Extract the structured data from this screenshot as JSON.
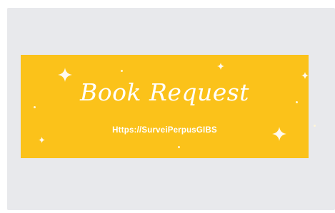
{
  "banner": {
    "title": "Book Request",
    "url": "Https://SurveiPerpusGIBS"
  },
  "colors": {
    "banner_bg": "#fbc21a",
    "text": "#ffffff",
    "backdrop": "#e8e9ec"
  },
  "decorations": {
    "sparkle_icon": "sparkle-star-icon"
  }
}
